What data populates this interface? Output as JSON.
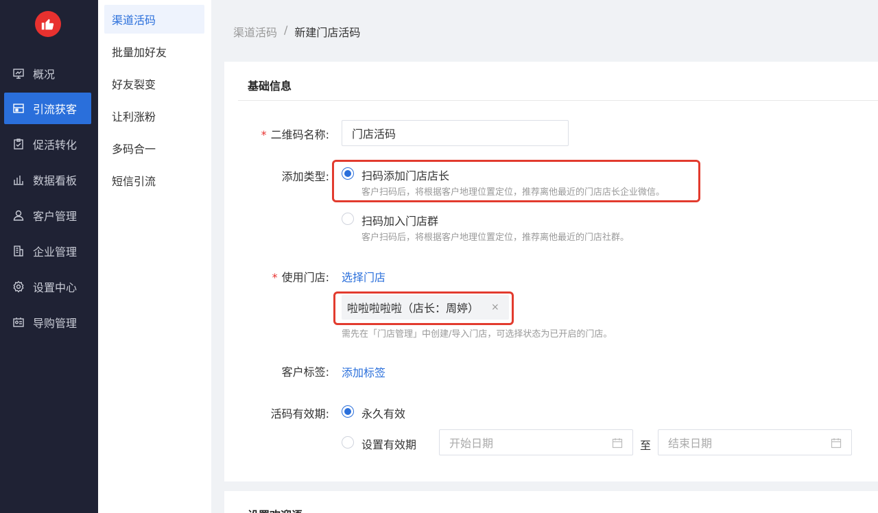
{
  "colors": {
    "sidebar_bg": "#1f2234",
    "accent": "#2a6fdb",
    "required": "#e8312f",
    "highlight": "#e23b2e"
  },
  "sidebar": {
    "items": [
      {
        "label": "概况",
        "icon": "dashboard-icon"
      },
      {
        "label": "引流获客",
        "icon": "store-icon",
        "active": true
      },
      {
        "label": "促活转化",
        "icon": "clipboard-icon"
      },
      {
        "label": "数据看板",
        "icon": "bar-chart-icon"
      },
      {
        "label": "客户管理",
        "icon": "user-icon"
      },
      {
        "label": "企业管理",
        "icon": "building-icon"
      },
      {
        "label": "设置中心",
        "icon": "gear-icon"
      },
      {
        "label": "导购管理",
        "icon": "id-card-icon"
      }
    ]
  },
  "submenu": {
    "items": [
      {
        "label": "渠道活码",
        "active": true
      },
      {
        "label": "批量加好友"
      },
      {
        "label": "好友裂变"
      },
      {
        "label": "让利涨粉"
      },
      {
        "label": "多码合一"
      },
      {
        "label": "短信引流"
      }
    ]
  },
  "breadcrumb": {
    "parent": "渠道活码",
    "separator": "/",
    "current": "新建门店活码"
  },
  "form": {
    "section_title": "基础信息",
    "required_mark": "*",
    "qr_name": {
      "label": "二维码名称:",
      "value": "门店活码"
    },
    "add_type": {
      "label": "添加类型:",
      "options": [
        {
          "label": "扫码添加门店店长",
          "desc": "客户扫码后，将根据客户地理位置定位，推荐离他最近的门店店长企业微信。",
          "selected": true
        },
        {
          "label": "扫码加入门店群",
          "desc": "客户扫码后，将根据客户地理位置定位，推荐离他最近的门店社群。",
          "selected": false
        }
      ]
    },
    "store": {
      "label": "使用门店:",
      "link": "选择门店",
      "tag": "啦啦啦啦啦（店长：周婷）",
      "tag_close": "×",
      "hint": "需先在「门店管理」中创建/导入门店，可选择状态为已开启的门店。"
    },
    "tags": {
      "label": "客户标签:",
      "link": "添加标签"
    },
    "validity": {
      "label": "活码有效期:",
      "options": [
        {
          "label": "永久有效",
          "selected": true
        },
        {
          "label": "设置有效期",
          "selected": false
        }
      ],
      "start_placeholder": "开始日期",
      "to": "至",
      "end_placeholder": "结束日期"
    }
  },
  "section2": {
    "title": "设置欢迎语"
  }
}
